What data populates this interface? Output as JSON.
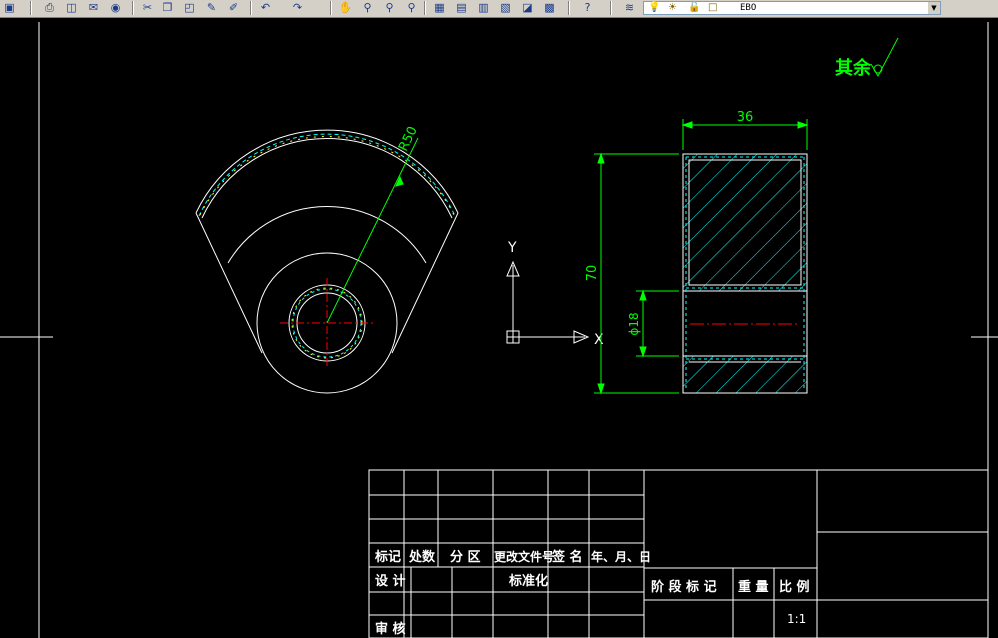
{
  "app": {
    "background": "#000000",
    "colors": {
      "geometry": "#ffffff",
      "dimension": "#00ff00",
      "hatch": "#00ffff",
      "centerline": "#ff0000",
      "note": "#00ff00"
    }
  },
  "toolbar": {
    "buttons": [
      {
        "name": "save-icon",
        "glyph": "▣"
      },
      {
        "name": "print-icon",
        "glyph": "⎙"
      },
      {
        "name": "plot-preview-icon",
        "glyph": "◫"
      },
      {
        "name": "publish-icon",
        "glyph": "✉"
      },
      {
        "name": "3d-orbit-icon",
        "glyph": "◉"
      },
      {
        "name": "cut-icon",
        "glyph": "✂"
      },
      {
        "name": "copy-icon",
        "glyph": "❐"
      },
      {
        "name": "paste-icon",
        "glyph": "◰"
      },
      {
        "name": "match-properties-icon",
        "glyph": "✎"
      },
      {
        "name": "block-editor-icon",
        "glyph": "✐"
      },
      {
        "name": "undo-icon",
        "glyph": "↶"
      },
      {
        "name": "redo-icon",
        "glyph": "↷"
      },
      {
        "name": "pan-icon",
        "glyph": "✋"
      },
      {
        "name": "zoom-realtime-icon",
        "glyph": "⚲"
      },
      {
        "name": "zoom-window-icon",
        "glyph": "⚲"
      },
      {
        "name": "zoom-previous-icon",
        "glyph": "⚲"
      },
      {
        "name": "properties-icon",
        "glyph": "▦"
      },
      {
        "name": "design-center-icon",
        "glyph": "▤"
      },
      {
        "name": "tool-palettes-icon",
        "glyph": "▥"
      },
      {
        "name": "sheet-set-icon",
        "glyph": "▧"
      },
      {
        "name": "markup-icon",
        "glyph": "◪"
      },
      {
        "name": "calculator-icon",
        "glyph": "▩"
      },
      {
        "name": "help-icon",
        "glyph": "?"
      },
      {
        "name": "layer-manager-icon",
        "glyph": "≋"
      },
      {
        "name": "layer-previous-icon",
        "glyph": "≋"
      },
      {
        "name": "layer-state-icon",
        "glyph": "≋"
      }
    ],
    "layer": {
      "name": "EBO",
      "state_icons": [
        {
          "name": "lightbulb-on-icon",
          "glyph": "💡"
        },
        {
          "name": "sun-thaw-icon",
          "glyph": "☀"
        },
        {
          "name": "lock-icon",
          "glyph": "🔓"
        },
        {
          "name": "color-swatch-icon",
          "glyph": "□"
        }
      ]
    }
  },
  "drawing": {
    "roughness_note": "其余",
    "dimensions": {
      "radius": "R50",
      "width": "36",
      "height": "70",
      "bore_diameter": "ϕ18"
    },
    "ucs": {
      "x_label": "X",
      "y_label": "Y"
    }
  },
  "title_block": {
    "row_headers": [
      "标记",
      "处数",
      "分 区",
      "更改文件号",
      "签 名",
      "年、月、日"
    ],
    "design_label": "设 计",
    "standardization_label": "标准化",
    "review_label": "审 核",
    "stage_mark_label": "阶 段 标 记",
    "weight_label": "重 量",
    "scale_label": "比 例",
    "scale_value": "1:1"
  }
}
